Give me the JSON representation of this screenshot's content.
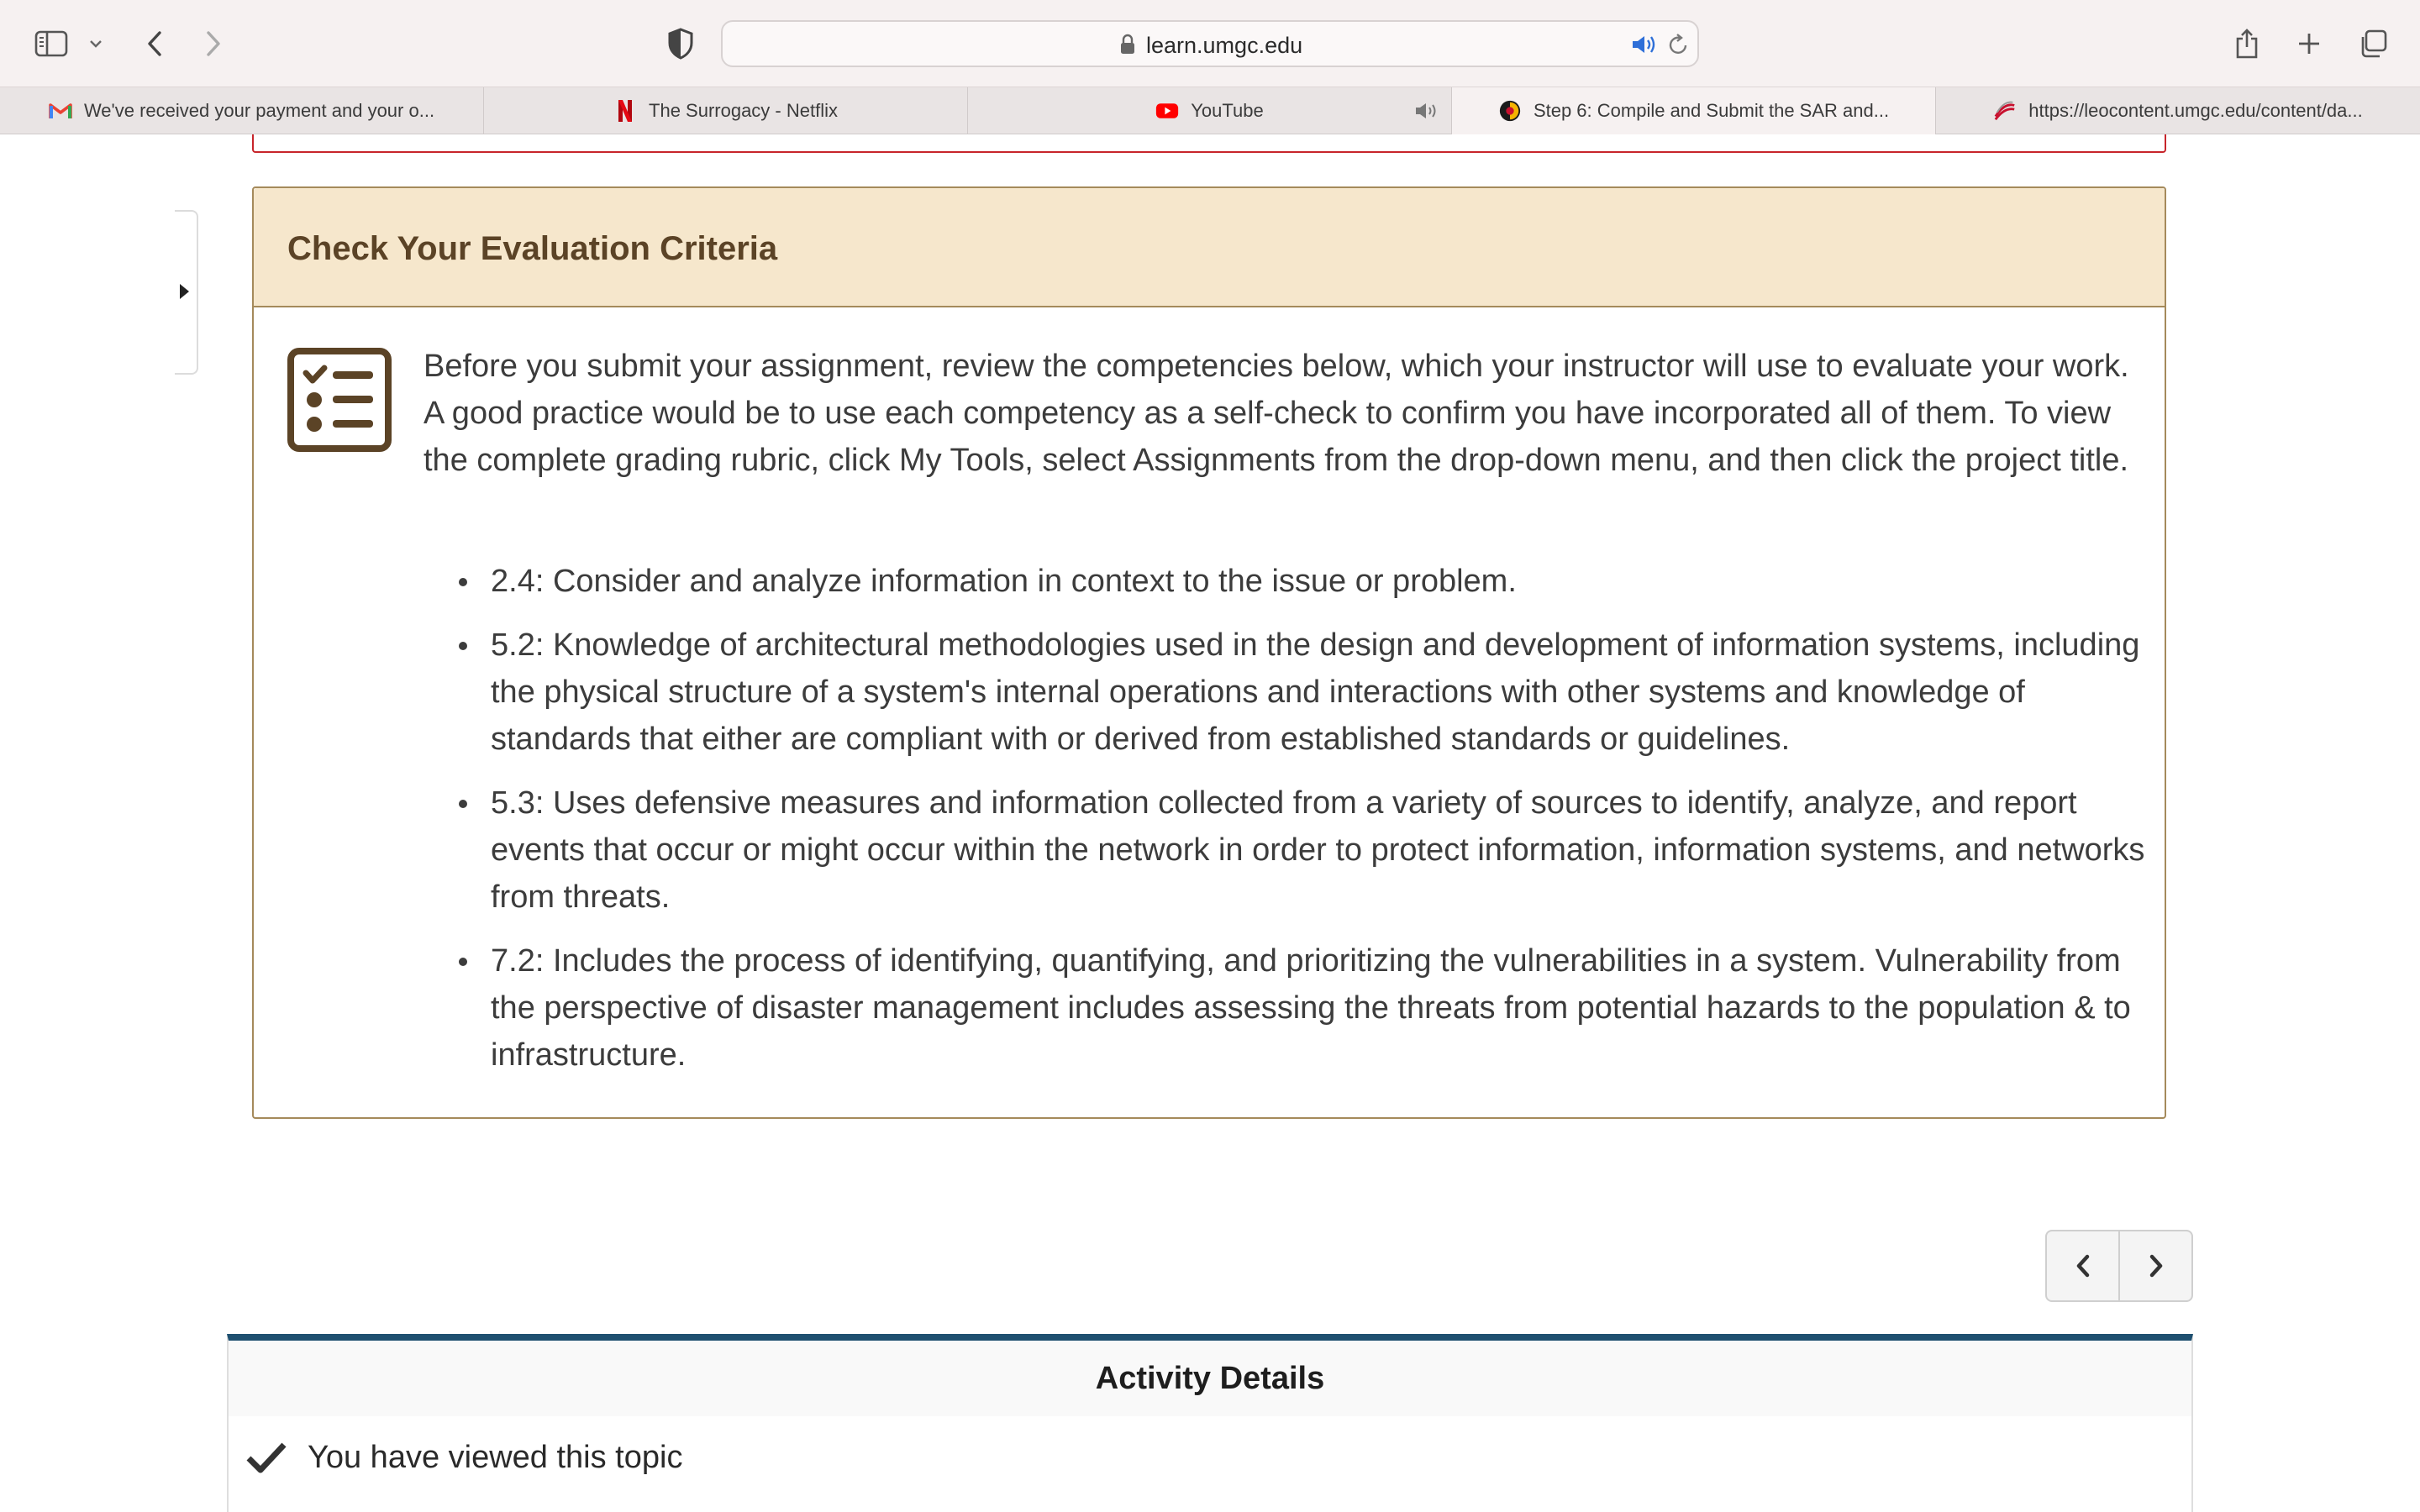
{
  "browser": {
    "url": "learn.umgc.edu",
    "tabs": [
      {
        "title": "We've received your payment and your o...",
        "icon": "gmail-icon"
      },
      {
        "title": "The Surrogacy - Netflix",
        "icon": "netflix-icon"
      },
      {
        "title": "YouTube",
        "icon": "youtube-icon",
        "muted_indicator": true
      },
      {
        "title": "Step 6: Compile and Submit the SAR and...",
        "icon": "d2l-icon",
        "active": true
      },
      {
        "title": "https://leocontent.umgc.edu/content/da...",
        "icon": "umgc-icon"
      }
    ]
  },
  "criteria": {
    "title": "Check Your Evaluation Criteria",
    "intro": "Before you submit your assignment, review the competencies below, which your instructor will use to evaluate your work. A good practice would be to use each competency as a self-check to confirm you have incorporated all of them. To view the complete grading rubric, click My Tools, select Assignments from the drop-down menu, and then click the project title.",
    "items": [
      "2.4: Consider and analyze information in context to the issue or problem.",
      "5.2: Knowledge of architectural methodologies used in the design and development of information systems, including the physical structure of a system's internal operations and interactions with other systems and knowledge of standards that either are compliant with or derived from established standards or guidelines.",
      "5.3: Uses defensive measures and information collected from a variety of sources to identify, analyze, and report events that occur or might occur within the network in order to protect information, information systems, and networks from threats.",
      "7.2: Includes the process of identifying, quantifying, and prioritizing the vulnerabilities in a system. Vulnerability from the perspective of disaster management includes assessing the threats from potential hazards to the population & to infrastructure."
    ]
  },
  "activity": {
    "title": "Activity Details",
    "status": "You have viewed this topic"
  },
  "colors": {
    "criteria_header_bg": "#f6e7cc",
    "criteria_border": "#a58a5b",
    "criteria_title": "#5b4326",
    "activity_accent": "#1f5070",
    "previous_box_border": "#c7252b"
  }
}
